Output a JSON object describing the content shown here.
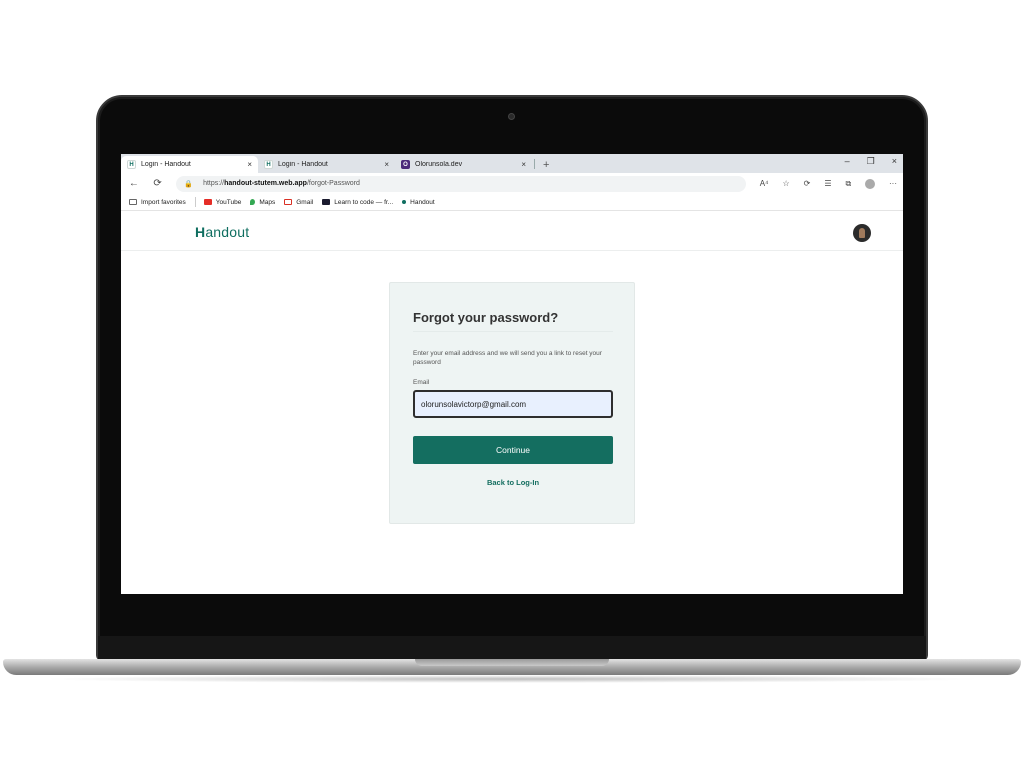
{
  "browser": {
    "tabs": [
      {
        "label": "Login - Handout",
        "close": "×",
        "favicon": "H"
      },
      {
        "label": "Login - Handout",
        "close": "×",
        "favicon": "H"
      },
      {
        "label": "Olorunsola.dev",
        "close": "×",
        "favicon": "O"
      }
    ],
    "new_tab": "+",
    "window_controls": {
      "minimize": "–",
      "restore": "❐",
      "close": "×"
    },
    "address_bar": {
      "scheme": "https://",
      "host": "handout-stutem.web.app",
      "path": "/forgot-Password"
    },
    "toolbar_icons": {
      "read_aloud": "A⁴",
      "favorite": "☆",
      "refresh": "⟳",
      "favorites_list": "☰",
      "collections": "⧉",
      "more": "···"
    },
    "nav": {
      "back": "←",
      "reload": "⟳",
      "lock": "🔒"
    },
    "favorites_bar": [
      {
        "label": "Import favorites",
        "color": "#666666"
      },
      {
        "label": "YouTube",
        "color": "#e52d27"
      },
      {
        "label": "Maps",
        "color": "#34a853"
      },
      {
        "label": "Gmail",
        "color": "#d93025"
      },
      {
        "label": "Learn to code — fr...",
        "color": "#1a1a2e"
      },
      {
        "label": "Handout",
        "color": "#0f6e60"
      }
    ]
  },
  "app": {
    "logo": {
      "first": "H",
      "rest": "andout"
    },
    "title": "Forgot your password?",
    "description": "Enter your email address and we will send you a link to reset your password",
    "email_label": "Email",
    "email_value": "olorunsolavictorp@gmail.com",
    "continue_label": "Continue",
    "back_link": "Back to Log-In",
    "accent_color": "#146e60"
  }
}
